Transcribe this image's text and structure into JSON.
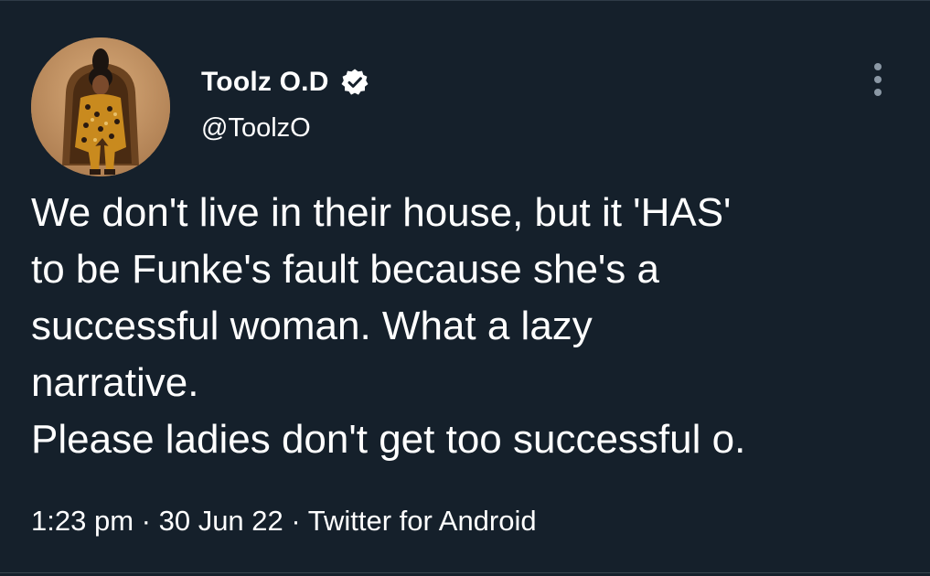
{
  "tweet": {
    "author": {
      "display_name": "Toolz O.D",
      "handle": "@ToolzO",
      "verified_icon": "verified-badge-icon",
      "avatar": "profile-photo"
    },
    "more_icon": "more-options-icon",
    "text_lines": [
      "We don't live in their house, but it 'HAS'",
      "to be Funke's fault because she's a",
      "successful woman. What a lazy",
      "narrative.",
      "Please ladies don't get too successful o."
    ],
    "meta": {
      "time": "1:23 pm",
      "separator": "·",
      "date": "30 Jun 22",
      "source": "Twitter for Android"
    }
  },
  "colors": {
    "background": "#15202b",
    "text": "#ffffff",
    "secondary": "#8b98a5",
    "verified_badge": "#ffffff"
  }
}
